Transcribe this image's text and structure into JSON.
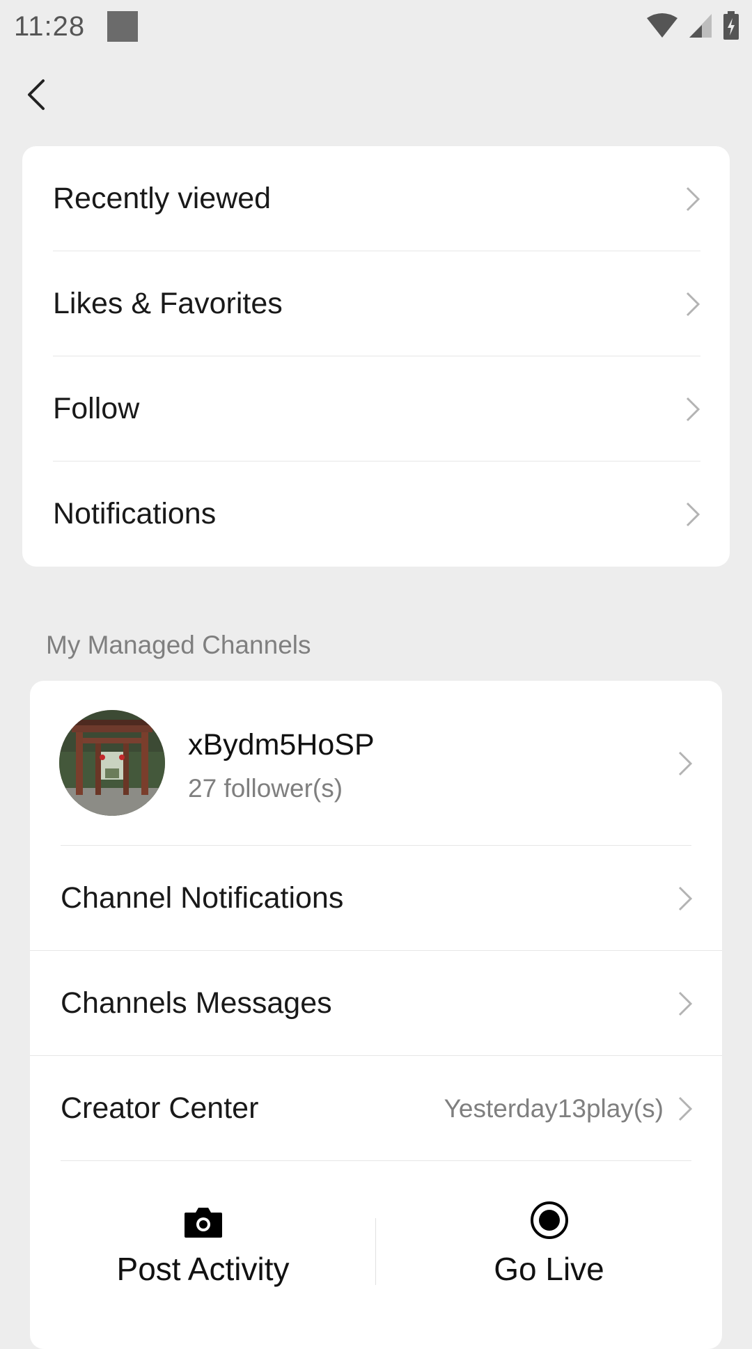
{
  "status_bar": {
    "time": "11:28"
  },
  "menu": {
    "items": [
      {
        "label": "Recently viewed"
      },
      {
        "label": "Likes & Favorites"
      },
      {
        "label": "Follow"
      },
      {
        "label": "Notifications"
      }
    ]
  },
  "managed_channels": {
    "section_title": "My Managed Channels",
    "channel": {
      "name": "xBydm5HoSP",
      "followers": "27 follower(s)"
    },
    "rows": [
      {
        "label": "Channel Notifications"
      },
      {
        "label": "Channels Messages"
      },
      {
        "label": "Creator Center",
        "detail": "Yesterday13play(s)"
      }
    ],
    "actions": [
      {
        "label": "Post Activity",
        "icon": "camera-icon"
      },
      {
        "label": "Go Live",
        "icon": "live-record-icon"
      }
    ]
  },
  "colors": {
    "background": "#ededed",
    "card": "#ffffff",
    "primary_text": "#191919",
    "secondary_text": "#7f7f7f",
    "separator": "#e6e6e6"
  }
}
